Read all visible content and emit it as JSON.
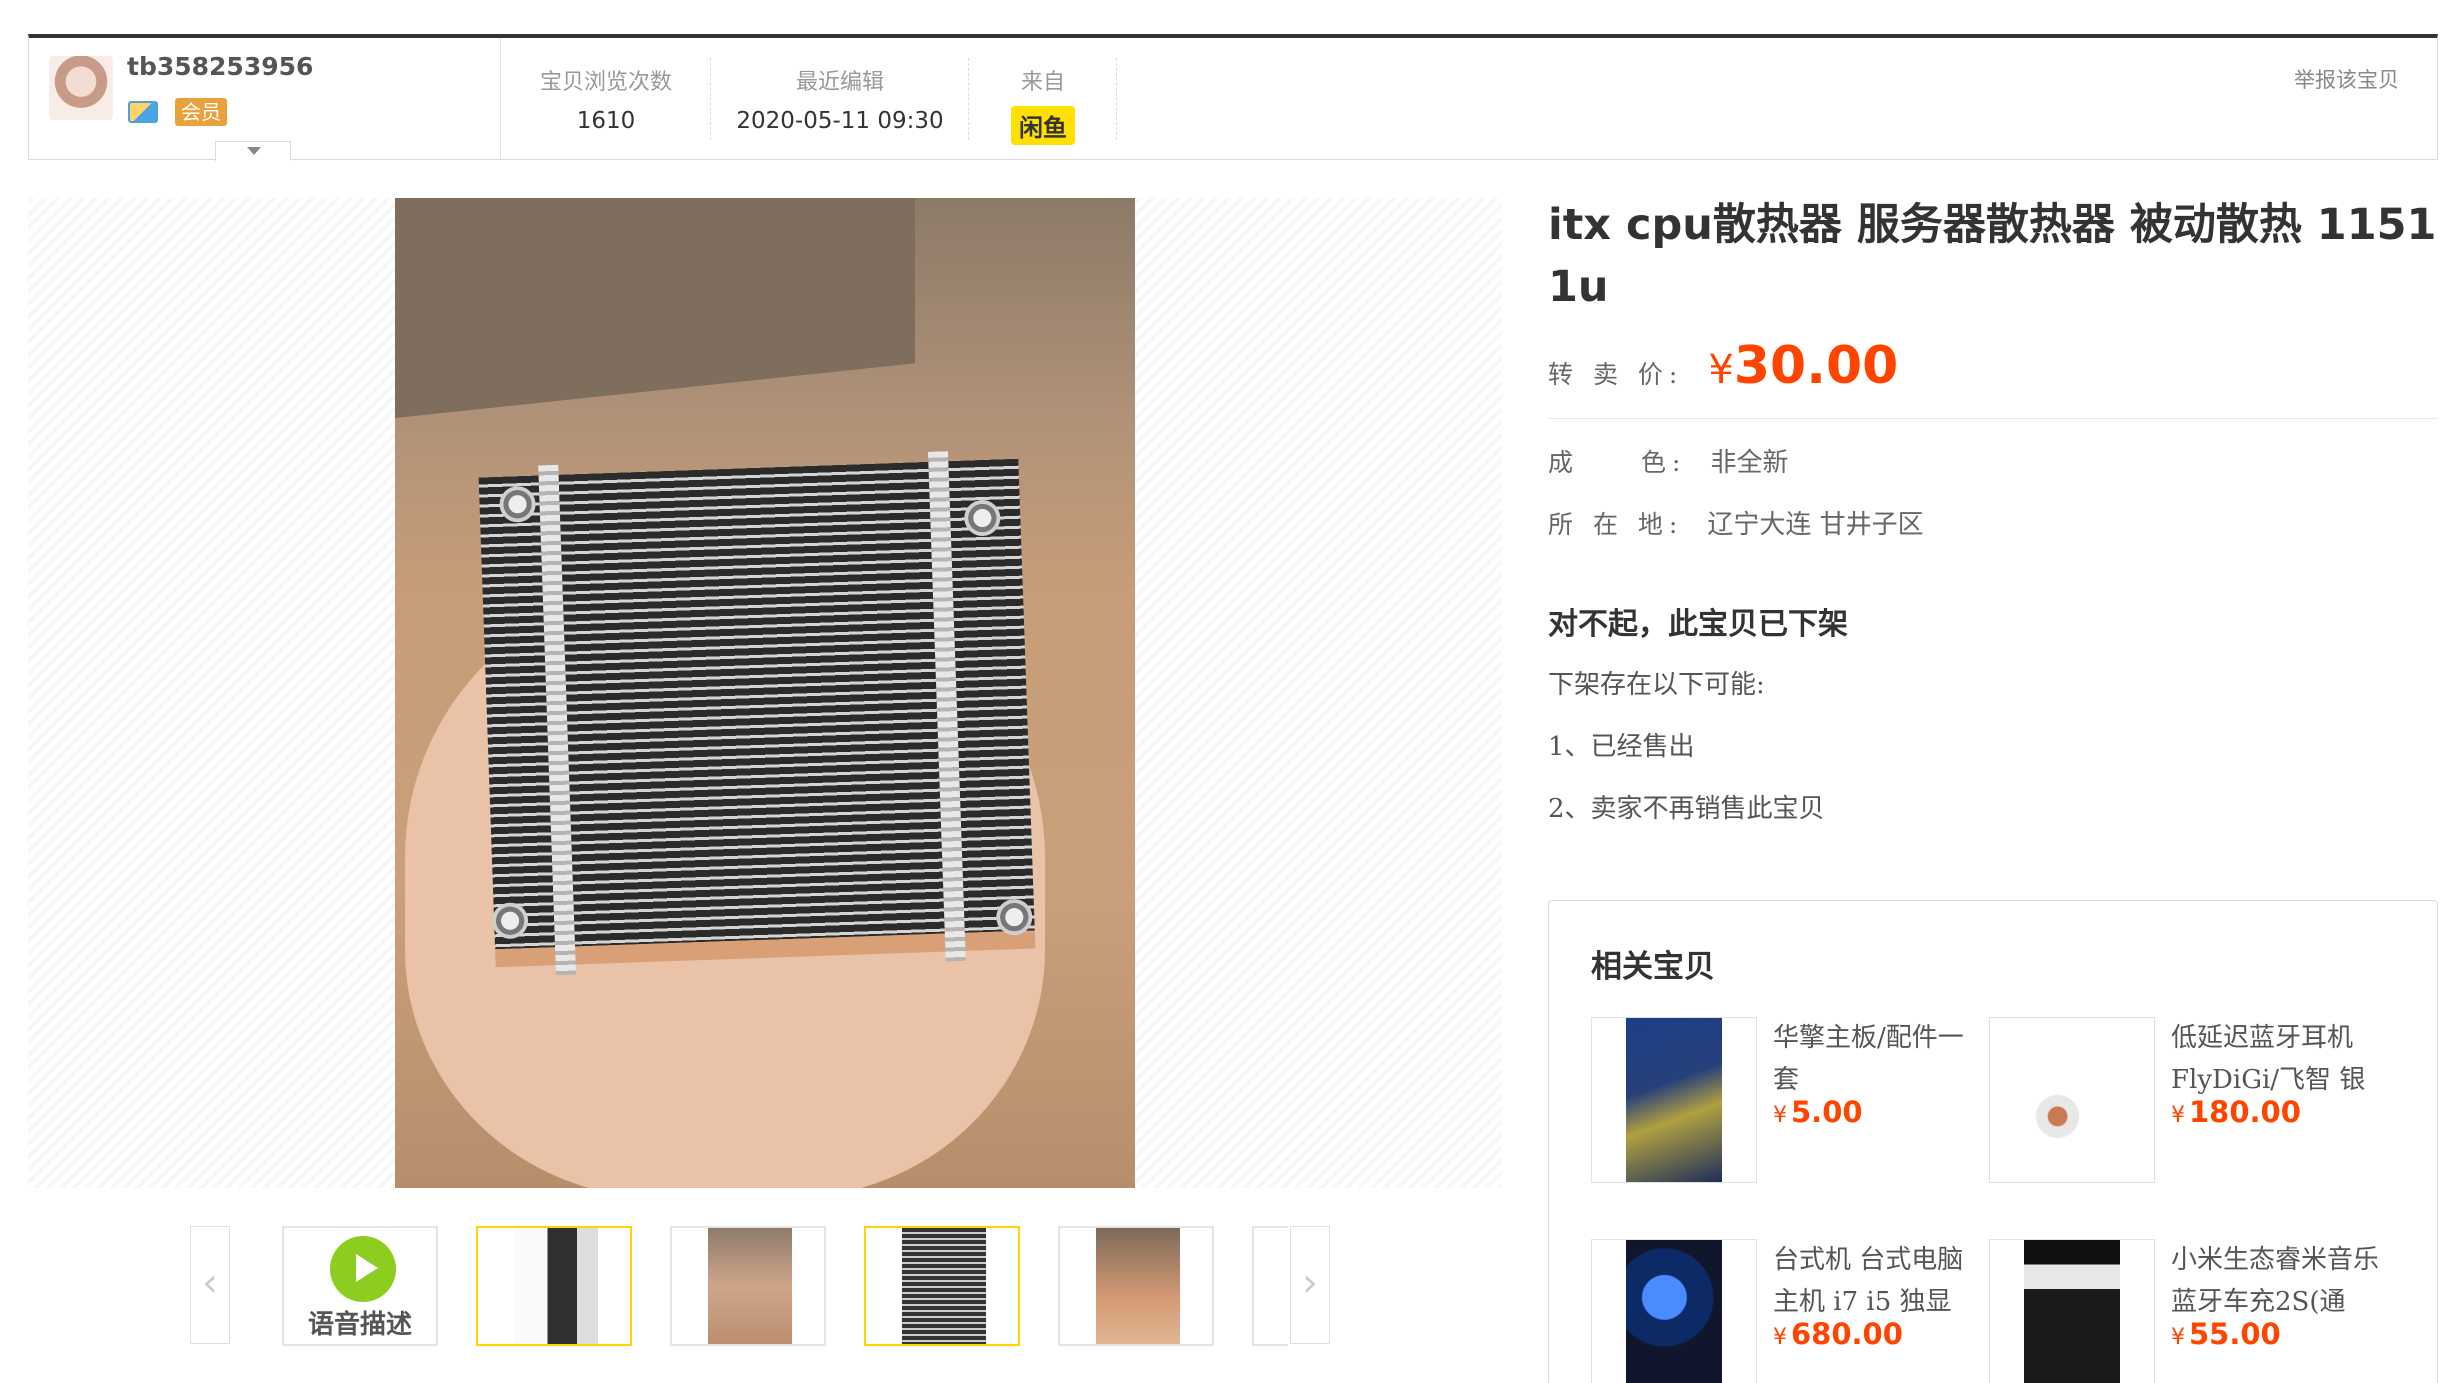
{
  "seller": {
    "name": "tb358253956",
    "member_badge": "会员"
  },
  "stats": {
    "views_label": "宝贝浏览次数",
    "views_value": "1610",
    "edited_label": "最近编辑",
    "edited_value": "2020-05-11 09:30",
    "source_label": "来自",
    "source_value": "闲鱼"
  },
  "report_label": "举报该宝贝",
  "gallery": {
    "voice_label": "语音描述",
    "prev_icon": "‹",
    "next_icon": "›"
  },
  "item": {
    "title": "itx cpu散热器 服务器散热器 被动散热 1151 1u",
    "price_label": "转 卖 价:",
    "currency": "¥",
    "price": "30.00",
    "condition_label": "成　　色:",
    "condition_value": "非全新",
    "location_label": "所 在 地:",
    "location_value": "辽宁大连 甘井子区"
  },
  "offline": {
    "title": "对不起，此宝贝已下架",
    "reason_intro": "下架存在以下可能:",
    "reasons": [
      "1、已经售出",
      "2、卖家不再销售此宝贝"
    ]
  },
  "related": {
    "heading": "相关宝贝",
    "items": [
      {
        "title": "华擎主板/配件一套",
        "price": "5.00"
      },
      {
        "title": "低延迟蓝牙耳机 FlyDiGi/飞智 银",
        "price": "180.00"
      },
      {
        "title": "台式机 台式电脑 主机 i7 i5 独显",
        "price": "680.00"
      },
      {
        "title": "小米生态睿米音乐蓝牙车充2S(通",
        "price": "55.00"
      }
    ]
  },
  "colors": {
    "accent_price": "#ff4400",
    "active_thumb_border": "#ffd400",
    "xianyu_yellow": "#ffe000",
    "voice_green": "#8ccd1f"
  }
}
